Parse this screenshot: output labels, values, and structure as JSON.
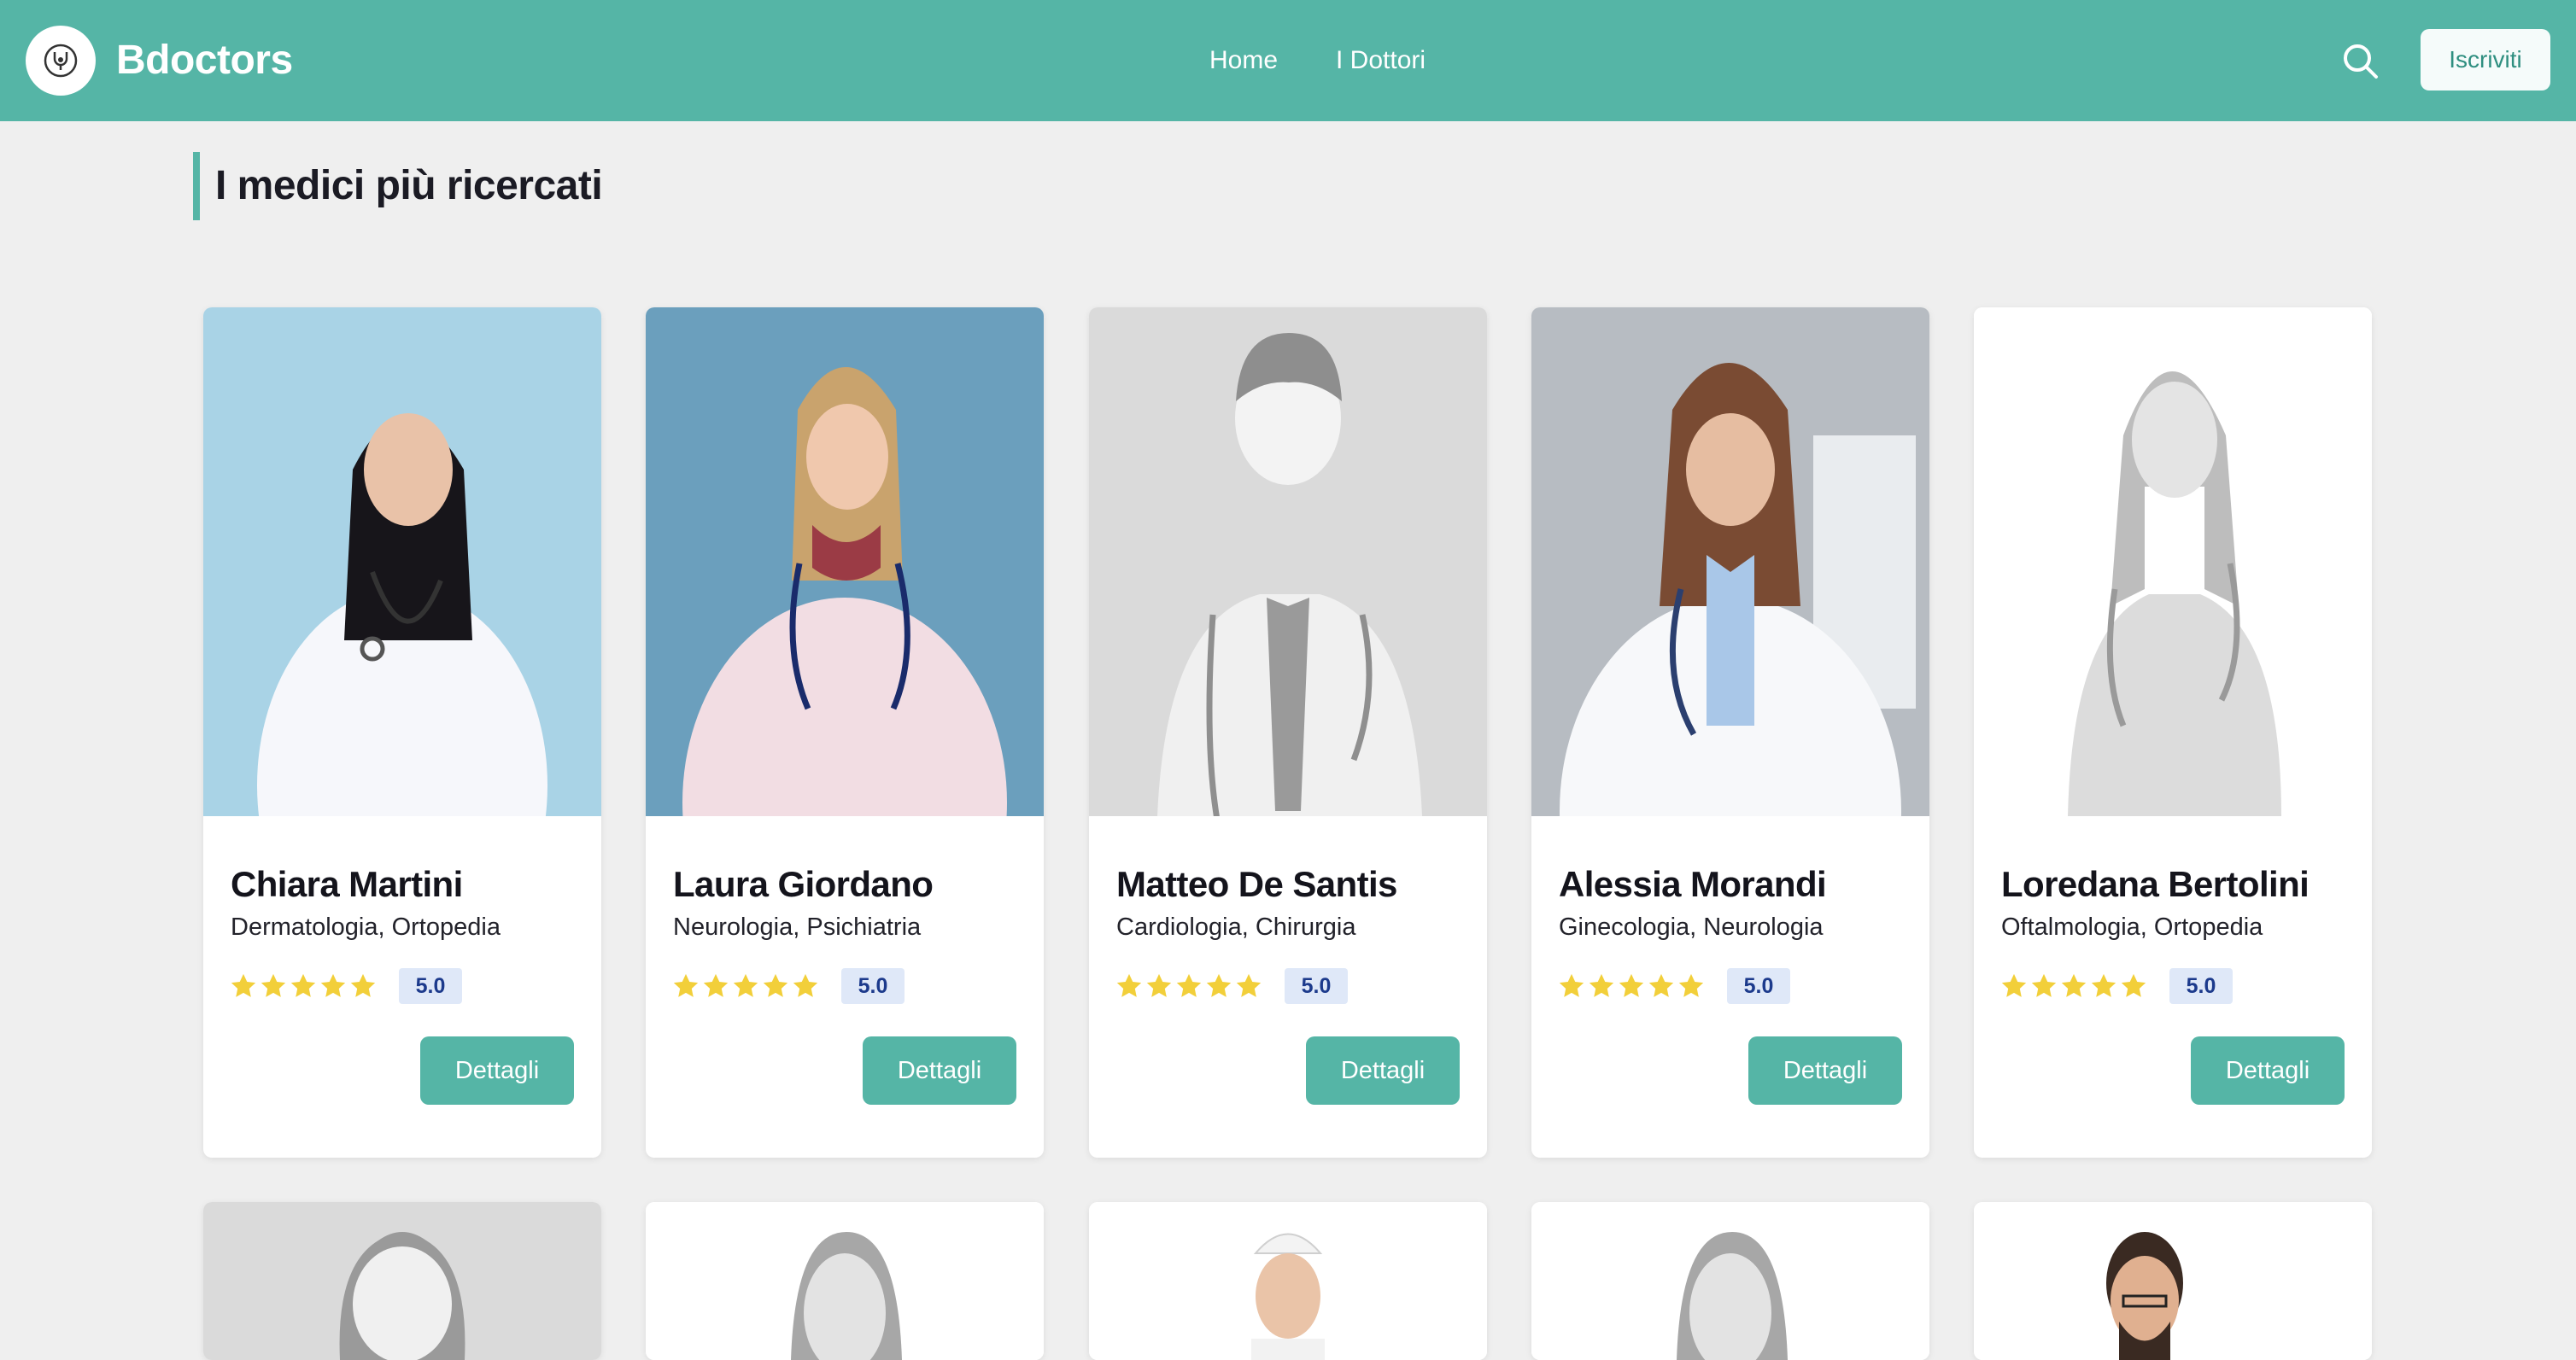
{
  "header": {
    "brand": "Bdoctors",
    "logo_icon": "stethoscope-icon",
    "nav": [
      {
        "label": "Home"
      },
      {
        "label": "I Dottori"
      }
    ],
    "search_icon": "search-icon",
    "signup_label": "Iscriviti",
    "bg_color": "#55b5a6"
  },
  "section": {
    "title": "I medici più ricercati"
  },
  "doctors": [
    {
      "name": "Chiara Martini",
      "specialties": "Dermatologia, Ortopedia",
      "rating": "5.0",
      "stars": 5,
      "details_label": "Dettagli"
    },
    {
      "name": "Laura Giordano",
      "specialties": "Neurologia, Psichiatria",
      "rating": "5.0",
      "stars": 5,
      "details_label": "Dettagli"
    },
    {
      "name": "Matteo De Santis",
      "specialties": "Cardiologia, Chirurgia",
      "rating": "5.0",
      "stars": 5,
      "details_label": "Dettagli"
    },
    {
      "name": "Alessia Morandi",
      "specialties": "Ginecologia, Neurologia",
      "rating": "5.0",
      "stars": 5,
      "details_label": "Dettagli"
    },
    {
      "name": "Loredana Bertolini",
      "specialties": "Oftalmologia, Ortopedia",
      "rating": "5.0",
      "stars": 5,
      "details_label": "Dettagli"
    }
  ],
  "colors": {
    "accent": "#55b5a6",
    "star": "#f2cf3a",
    "rating_badge_bg": "#dfe8f8",
    "rating_badge_text": "#1c3a8c"
  }
}
